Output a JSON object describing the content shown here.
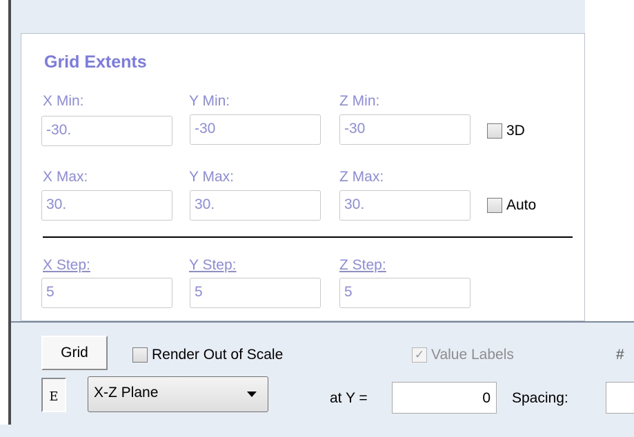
{
  "grid_extents": {
    "title": "Grid Extents",
    "x_min": {
      "label": "X Min:",
      "value": "-30."
    },
    "y_min": {
      "label": "Y Min:",
      "value": "-30"
    },
    "z_min": {
      "label": "Z Min:",
      "value": "-30"
    },
    "x_max": {
      "label": "X Max:",
      "value": "30."
    },
    "y_max": {
      "label": "Y Max:",
      "value": "30."
    },
    "z_max": {
      "label": "Z Max:",
      "value": "30."
    },
    "x_step": {
      "label": "X Step:",
      "value": "5"
    },
    "y_step": {
      "label": "Y Step:",
      "value": "5"
    },
    "z_step": {
      "label": "Z Step:",
      "value": "5"
    },
    "checkbox_3d": {
      "label": "3D",
      "checked": false
    },
    "checkbox_auto": {
      "label": "Auto",
      "checked": false
    }
  },
  "toolbar": {
    "grid_button": "Grid",
    "render_out_of_scale": {
      "label": "Render Out of Scale",
      "checked": false
    },
    "value_labels": {
      "label": "Value Labels",
      "checked": true,
      "enabled": false
    },
    "hash_label": "#",
    "e_button": "E",
    "plane_select": {
      "value": "X-Z Plane"
    },
    "at_y_label": "at Y =",
    "at_y_value": "0",
    "spacing_label": "Spacing:",
    "spacing_value": ""
  },
  "colors": {
    "accent": "#7a7ae8",
    "label": "#8a8ae8"
  }
}
